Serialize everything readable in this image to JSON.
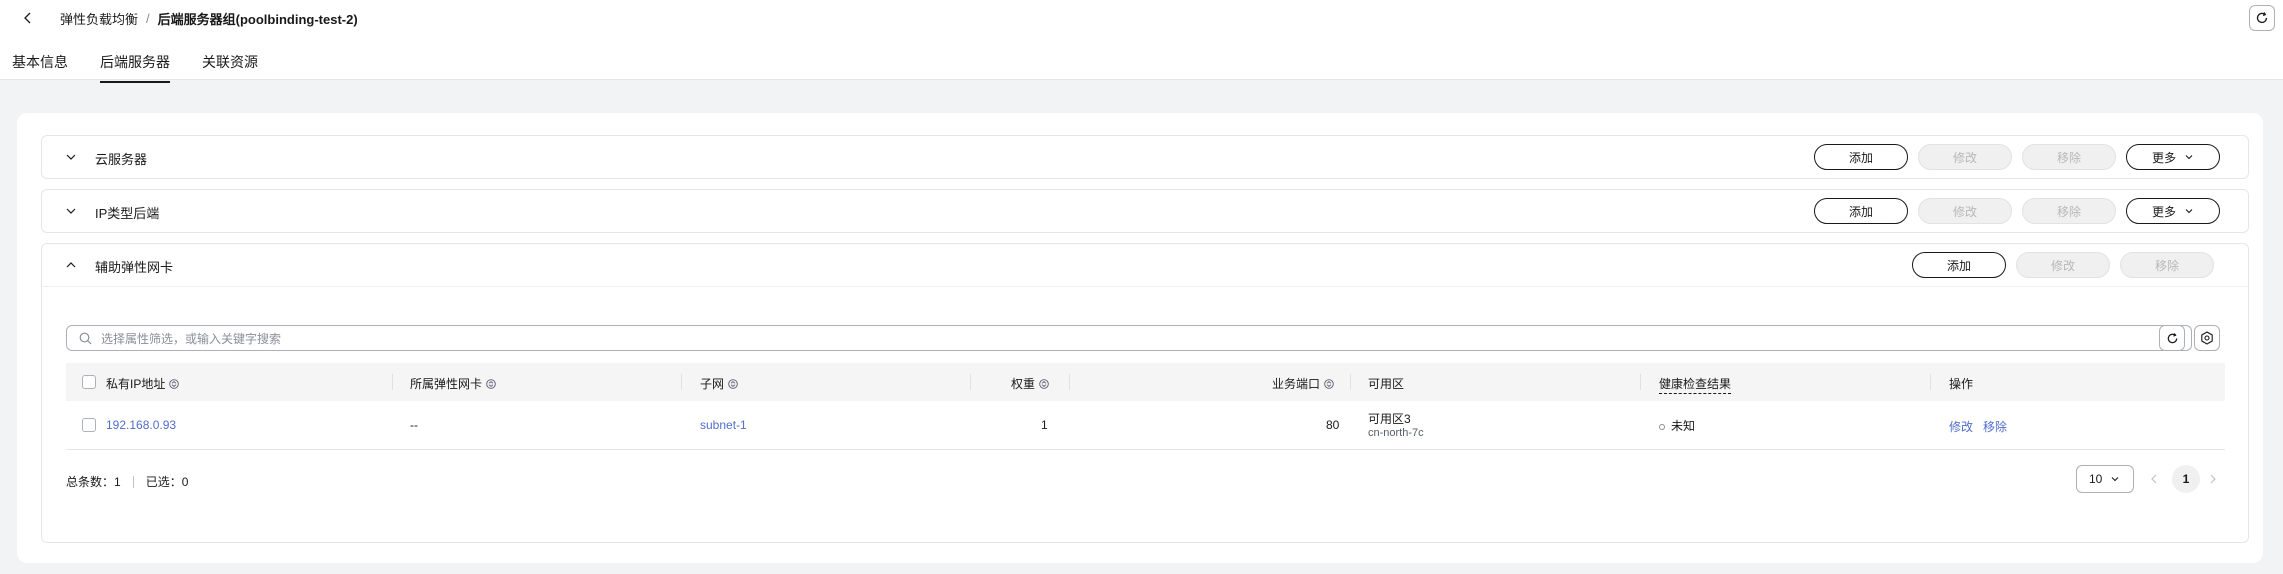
{
  "breadcrumb": {
    "parent": "弹性负载均衡",
    "separator": "/",
    "current": "后端服务器组(poolbinding-test-2)"
  },
  "tabs": [
    {
      "label": "基本信息",
      "active": false
    },
    {
      "label": "后端服务器",
      "active": true
    },
    {
      "label": "关联资源",
      "active": false
    }
  ],
  "sections": {
    "cloud_server": {
      "title": "云服务器",
      "expanded": false,
      "add": "添加",
      "modify": "修改",
      "remove": "移除",
      "more": "更多"
    },
    "ip_backend": {
      "title": "IP类型后端",
      "expanded": false,
      "add": "添加",
      "modify": "修改",
      "remove": "移除",
      "more": "更多"
    },
    "eni": {
      "title": "辅助弹性网卡",
      "expanded": true,
      "add": "添加",
      "modify": "修改",
      "remove": "移除",
      "search_placeholder": "选择属性筛选，或输入关键字搜索",
      "columns": {
        "private_ip": "私有IP地址",
        "eni": "所属弹性网卡",
        "subnet": "子网",
        "weight": "权重",
        "port": "业务端口",
        "az": "可用区",
        "health": "健康检查结果",
        "actions": "操作"
      },
      "rows": [
        {
          "private_ip": "192.168.0.93",
          "eni": "--",
          "subnet": "subnet-1",
          "weight": "1",
          "port": "80",
          "az_name": "可用区3",
          "az_id": "cn-north-7c",
          "health": "未知",
          "action_modify": "修改",
          "action_remove": "移除"
        }
      ],
      "footer": {
        "total_label": "总条数：1",
        "selected_label": "已选：0",
        "page_size": "10",
        "current_page": "1"
      }
    }
  },
  "colors": {
    "link": "#526ecc",
    "background": "#f2f3f5",
    "border": "#e6e6e6"
  }
}
